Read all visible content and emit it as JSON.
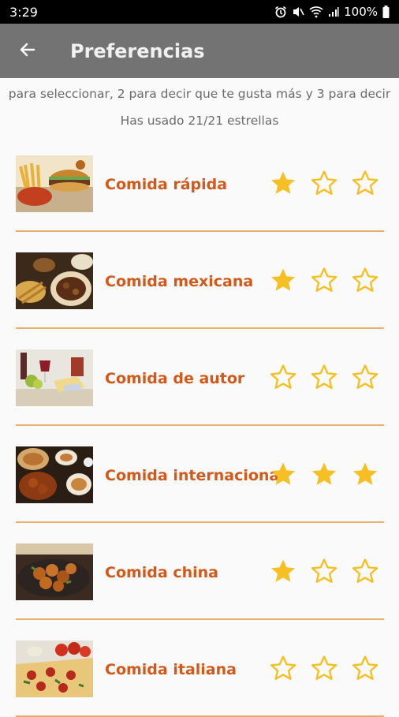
{
  "status_bar": {
    "time": "3:29",
    "battery": "100%"
  },
  "header": {
    "title": "Preferencias"
  },
  "instructions": "para seleccionar, 2 para decir que te gusta más y 3 para decir",
  "usage": "Has usado 21/21 estrellas",
  "colors": {
    "star": "#f6c024",
    "label": "#d2591a",
    "divider": "#e8b06a",
    "app_bar": "#737373"
  },
  "items": [
    {
      "label": "Comida rápida",
      "rating": 1,
      "image": "fast-food-image"
    },
    {
      "label": "Comida mexicana",
      "rating": 1,
      "image": "mexican-food-image"
    },
    {
      "label": "Comida de autor",
      "rating": 0,
      "image": "gourmet-food-image"
    },
    {
      "label": "Comida internacional",
      "rating": 3,
      "image": "international-food-image"
    },
    {
      "label": "Comida china",
      "rating": 1,
      "image": "chinese-food-image"
    },
    {
      "label": "Comida italiana",
      "rating": 0,
      "image": "italian-food-image"
    }
  ]
}
